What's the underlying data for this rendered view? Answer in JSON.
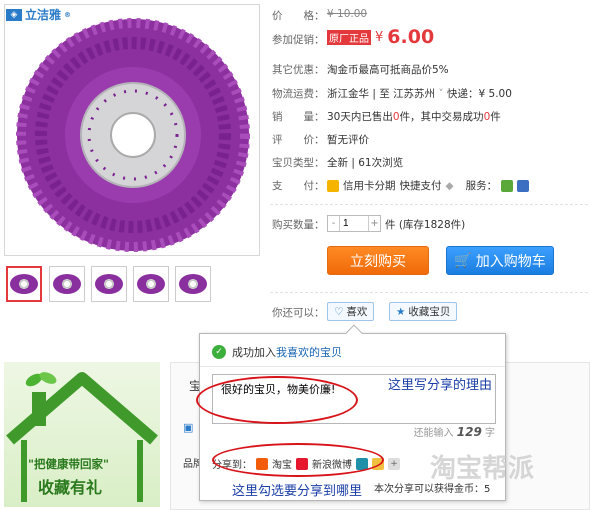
{
  "brand": {
    "name": "立洁雅",
    "mark": "®"
  },
  "info": {
    "price_label": "价　　格：",
    "price_old": "¥ 10.00",
    "promo_label": "参加促销：",
    "promo_tag": "原厂正品",
    "promo_currency": "¥",
    "promo_price": "6.00",
    "other_label": "其它优惠：",
    "other_value": "淘金币最高可抵商品价5%",
    "ship_label": "物流运费：",
    "ship_from": "浙江金华",
    "ship_sep": " | 至 ",
    "ship_to": "江苏苏州",
    "ship_method": "快递：¥ 5.00",
    "sales_label": "销　　量：",
    "sales_pre": "30天内已售出",
    "sales_n": "0",
    "sales_mid": "件，其中交易成功",
    "sales_n2": "0",
    "sales_post": "件",
    "review_label": "评　　价：",
    "review_value": "暂无评价",
    "type_label": "宝贝类型：",
    "type_value": "全新  |  61次浏览",
    "pay_label": "支　　付：",
    "pay_credit": "信用卡分期",
    "pay_fast": "快捷支付",
    "service_label": "服务："
  },
  "purchase": {
    "qty_label": "购买数量：",
    "qty_value": "1",
    "stock": "件 (库存1828件)",
    "buy": "立刻购买",
    "cart": "加入购物车"
  },
  "actions": {
    "label": "你还可以：",
    "like": "喜欢",
    "fav": "收藏宝贝"
  },
  "promo": {
    "line1": "\"把健康带回家\"",
    "line2": "收藏有礼"
  },
  "bg": {
    "tab_char": "宝",
    "row_label": "品牌"
  },
  "popup": {
    "success_pre": "成功加入",
    "success_link": "我喜欢的宝贝",
    "share_text": "很好的宝贝，物美价廉!",
    "count_label": "还能输入",
    "count_value": "129",
    "count_unit": "字",
    "share_to": "分享到：",
    "taobao": "淘宝",
    "weibo": "新浪微博",
    "foot": "本次分享可以获得金币：5"
  },
  "notes": {
    "reason": "这里写分享的理由",
    "choose": "这里勾选要分享到哪里"
  },
  "watermark": "淘宝帮派",
  "colors": {
    "accent_red": "#e4393c",
    "buy_orange": "#f47a12",
    "cart_blue": "#2b8ce8",
    "annot_red": "#d8141b",
    "annot_blue": "#1a3ea6"
  }
}
